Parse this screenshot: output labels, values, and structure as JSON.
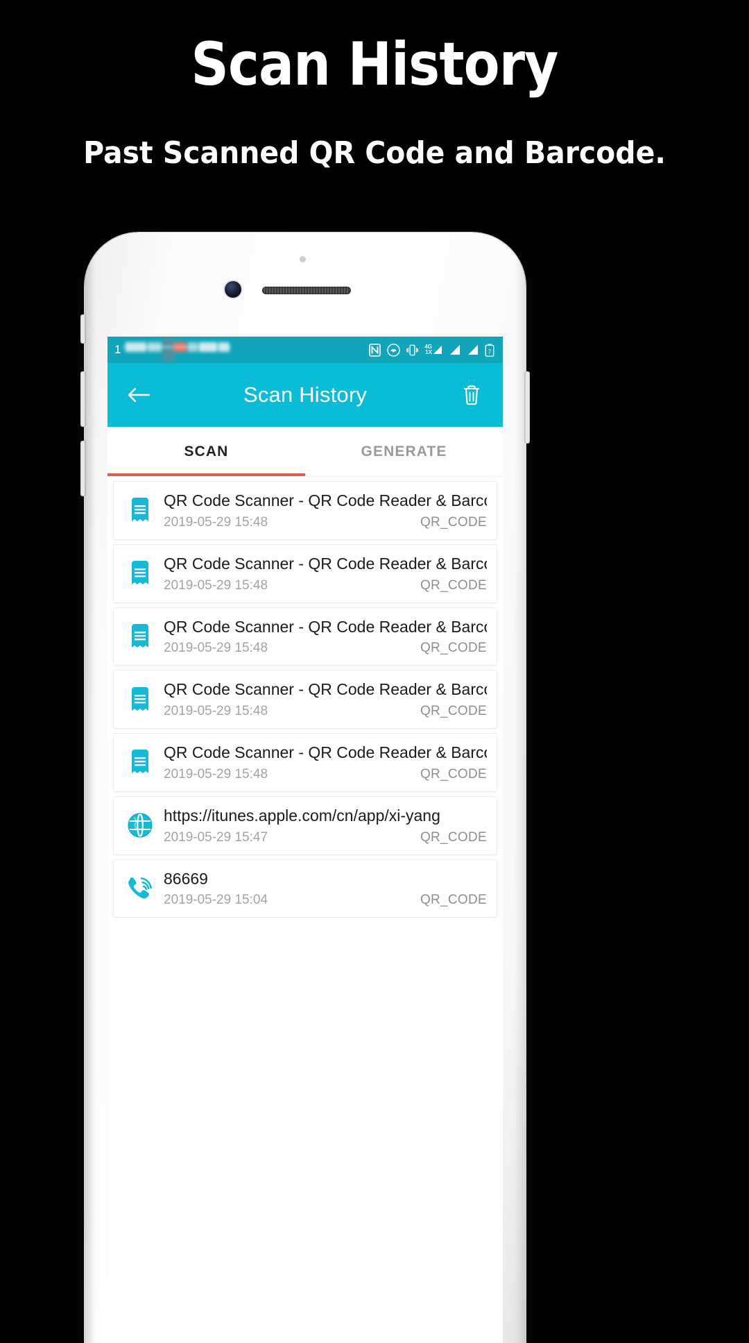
{
  "promo": {
    "title": "Scan History",
    "subtitle": "Past Scanned QR Code and Barcode."
  },
  "colors": {
    "statusbar": "#10a5b9",
    "toolbar": "#0bbcd6",
    "accent": "#16b9d8",
    "tab_indicator": "#d9604f",
    "background": "#000000"
  },
  "statusbar": {
    "time": "1",
    "icons": [
      "nfc-icon",
      "cast-icon",
      "vibrate-icon",
      "4g-1x-icon",
      "signal-icon",
      "signal-2-icon",
      "battery-icon"
    ],
    "network_label_top": "4G",
    "network_label_bottom": "1X",
    "battery_level": "7"
  },
  "toolbar": {
    "back_label": "back-arrow",
    "title": "Scan History",
    "delete_label": "delete"
  },
  "tabs": [
    {
      "label": "SCAN",
      "active": true
    },
    {
      "label": "GENERATE",
      "active": false
    }
  ],
  "list": [
    {
      "icon": "receipt-icon",
      "title": "QR Code Scanner - QR Code Reader & Barcode",
      "date": "2019-05-29 15:48",
      "type": "QR_CODE"
    },
    {
      "icon": "receipt-icon",
      "title": "QR Code Scanner - QR Code Reader & Barcode",
      "date": "2019-05-29 15:48",
      "type": "QR_CODE"
    },
    {
      "icon": "receipt-icon",
      "title": "QR Code Scanner - QR Code Reader & Barcode",
      "date": "2019-05-29 15:48",
      "type": "QR_CODE"
    },
    {
      "icon": "receipt-icon",
      "title": "QR Code Scanner - QR Code Reader & Barcode",
      "date": "2019-05-29 15:48",
      "type": "QR_CODE"
    },
    {
      "icon": "receipt-icon",
      "title": "QR Code Scanner - QR Code Reader & Barcode",
      "date": "2019-05-29 15:48",
      "type": "QR_CODE"
    },
    {
      "icon": "globe-icon",
      "title": "https://itunes.apple.com/cn/app/xi-yang",
      "date": "2019-05-29 15:47",
      "type": "QR_CODE"
    },
    {
      "icon": "phone-icon",
      "title": "86669",
      "date": "2019-05-29 15:04",
      "type": "QR_CODE"
    }
  ]
}
